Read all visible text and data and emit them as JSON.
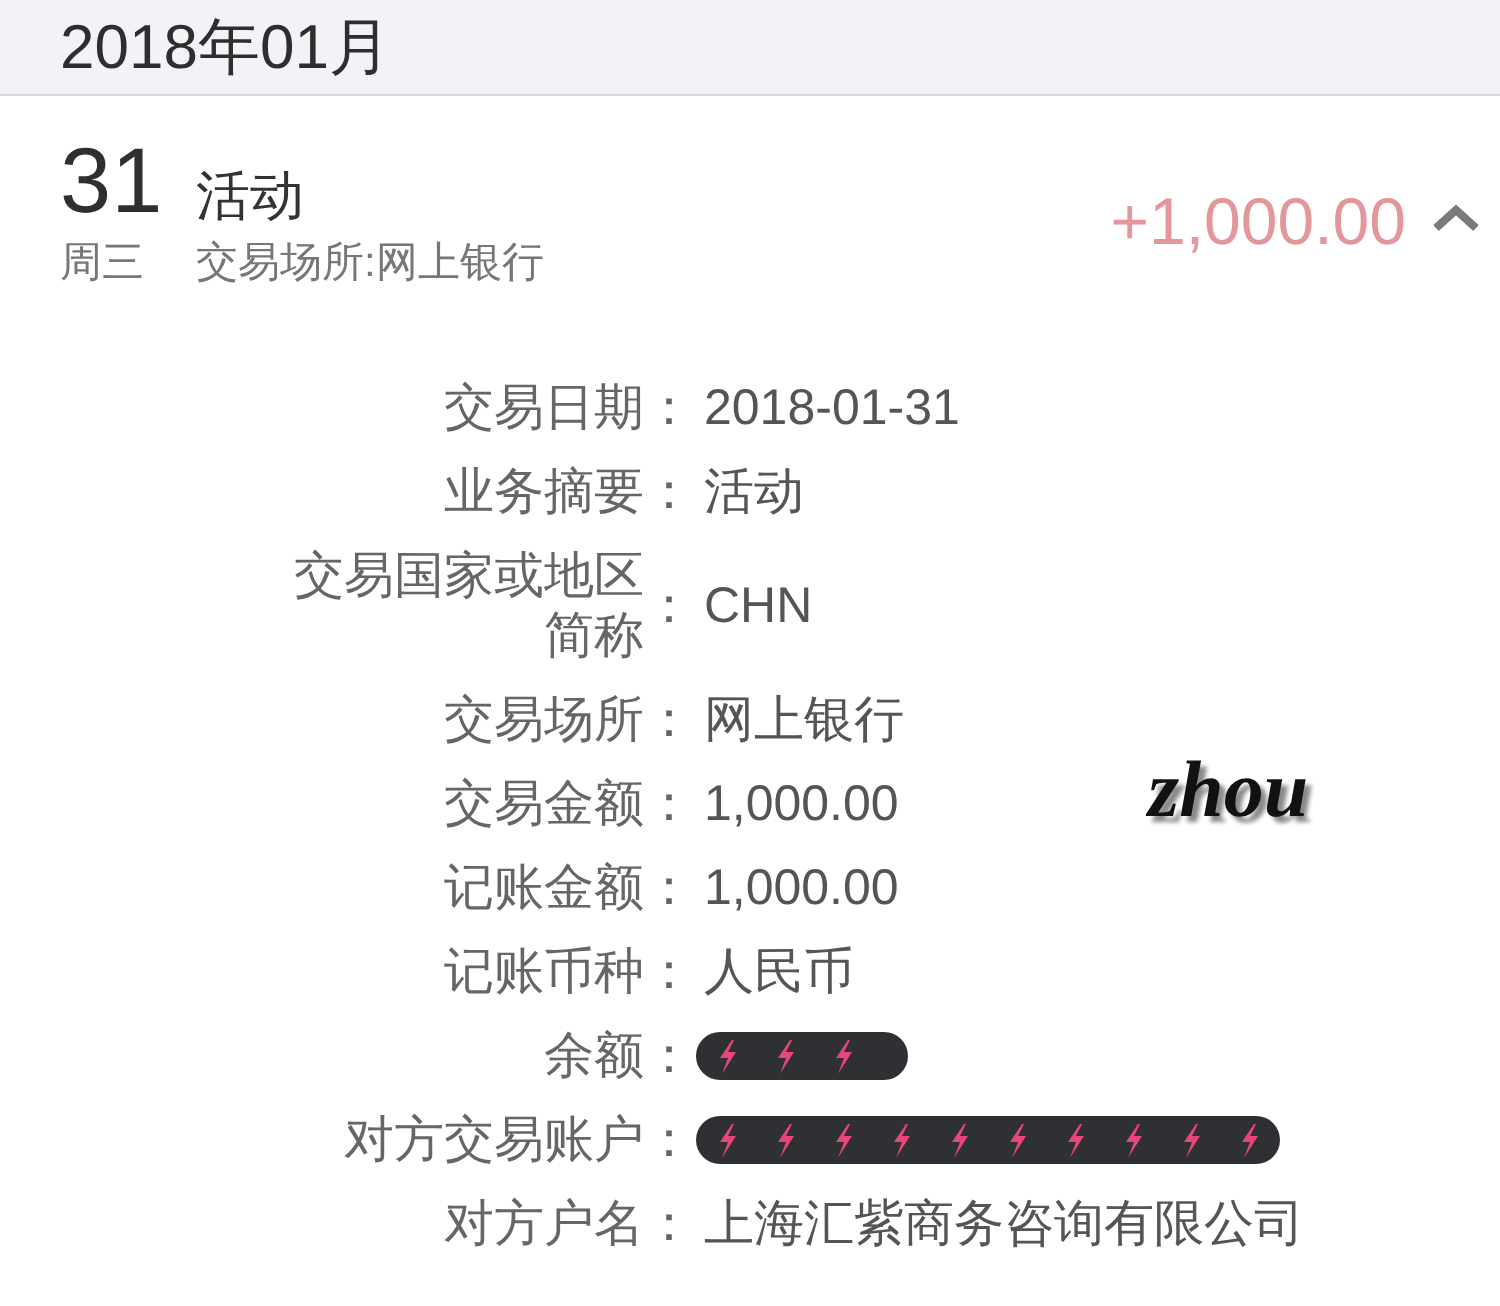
{
  "header": {
    "title": "2018年01月"
  },
  "transaction": {
    "day": "31",
    "title": "活动",
    "weekday": "周三",
    "subtitle": "交易场所:网上银行",
    "amount": "+1,000.00",
    "expanded": true
  },
  "details": [
    {
      "label": "交易日期",
      "separator": "：",
      "value": "2018-01-31",
      "redacted": false
    },
    {
      "label": "业务摘要",
      "separator": "：",
      "value": "活动",
      "redacted": false
    },
    {
      "label": "交易国家或地区简称",
      "separator": "：",
      "value": "CHN",
      "redacted": false
    },
    {
      "label": "交易场所",
      "separator": "：",
      "value": "网上银行",
      "redacted": false
    },
    {
      "label": "交易金额",
      "separator": "：",
      "value": "1,000.00",
      "redacted": false
    },
    {
      "label": "记账金额",
      "separator": "：",
      "value": "1,000.00",
      "redacted": false
    },
    {
      "label": "记账币种",
      "separator": "：",
      "value": "人民币",
      "redacted": false
    },
    {
      "label": "余额",
      "separator": "：",
      "redacted": true,
      "kind": "short"
    },
    {
      "label": "对方交易账户",
      "separator": "：",
      "redacted": true,
      "kind": "long"
    },
    {
      "label": "对方户名",
      "separator": "：",
      "value": "上海汇紫商务咨询有限公司",
      "redacted": false
    }
  ],
  "overlay_text": "zhou"
}
